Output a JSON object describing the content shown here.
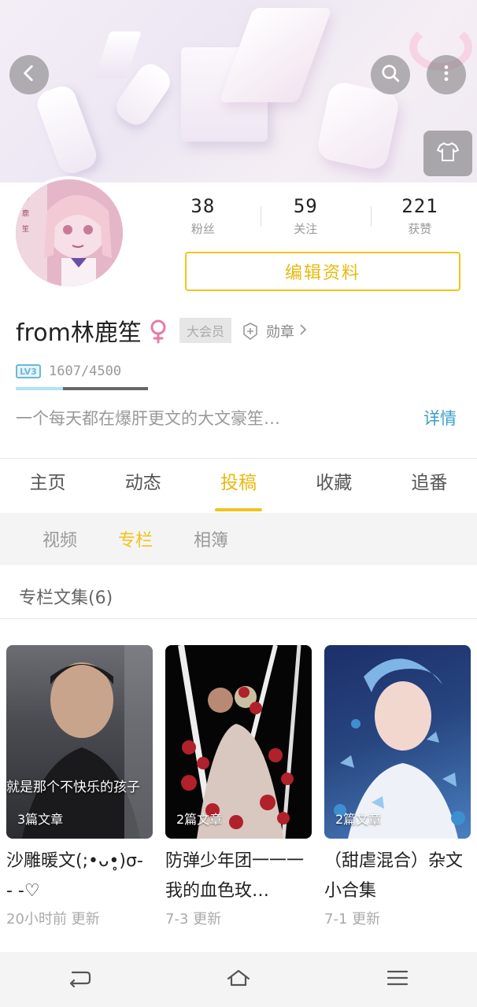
{
  "profile": {
    "stats": [
      {
        "value": "38",
        "label": "粉丝"
      },
      {
        "value": "59",
        "label": "关注"
      },
      {
        "value": "221",
        "label": "获赞"
      }
    ],
    "edit_label": "编辑资料",
    "username": "from林鹿笙",
    "vip_label": "大会员",
    "medal_label": "勋章",
    "level_badge": "LV3",
    "exp_text": "1607/4500",
    "exp_fraction": 0.357,
    "bio": "一个每天都在爆肝更文的大文豪笙…",
    "detail_label": "详情"
  },
  "tabs": [
    "主页",
    "动态",
    "投稿",
    "收藏",
    "追番"
  ],
  "active_tab": "投稿",
  "subtabs": [
    "视频",
    "专栏",
    "相簿"
  ],
  "active_subtab": "专栏",
  "collection_title": "专栏文集(6)",
  "cards": [
    {
      "count": "3篇文章",
      "caption": "就是那个不快乐的孩子",
      "title": "沙雕暖文(;•ᴗ•̥)σ- - -♡",
      "time": "20小时前 更新"
    },
    {
      "count": "2篇文章",
      "caption": "",
      "title": "防弹少年团一一一我的血色玫…",
      "time": "7-3 更新"
    },
    {
      "count": "2篇文章",
      "caption": "",
      "title": "（甜虐混合）杂文小合集",
      "time": "7-1 更新"
    }
  ],
  "colors": {
    "accent": "#f0c41b",
    "link": "#3a9ec9",
    "level": "#6cb8d9"
  },
  "icons": {
    "back": "back-icon",
    "search": "search-icon",
    "more": "more-vertical-icon",
    "skin": "tshirt-icon",
    "gender": "female-icon",
    "medal": "medal-icon",
    "nav_back": "back-arrow-icon",
    "nav_home": "home-icon",
    "nav_menu": "menu-icon"
  }
}
